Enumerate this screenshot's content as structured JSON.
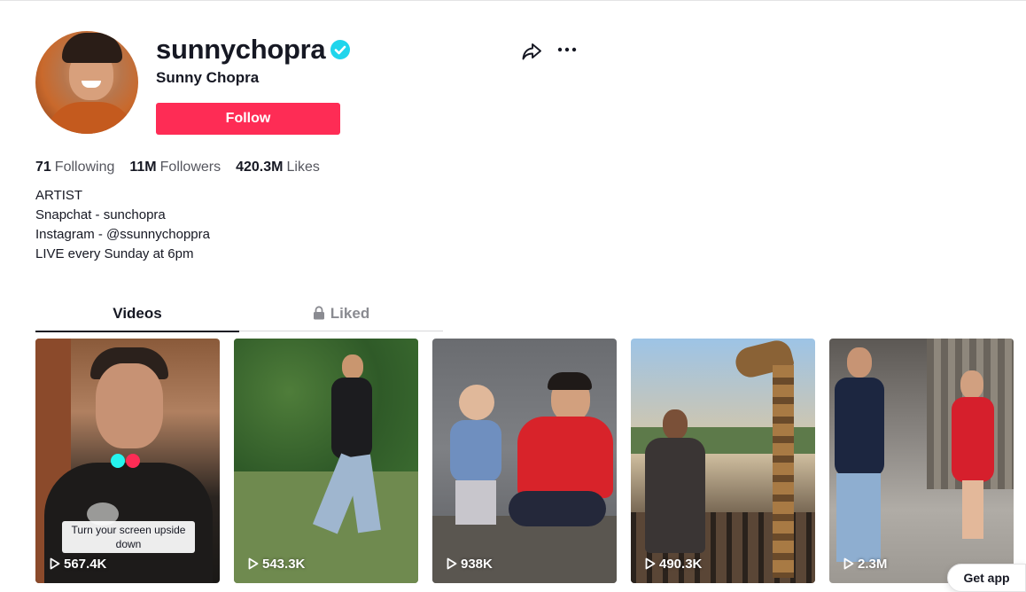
{
  "profile": {
    "username": "sunnychopra",
    "display_name": "Sunny Chopra",
    "follow_label": "Follow",
    "verified": true,
    "verified_color": "#20d5ec"
  },
  "stats": {
    "following_count": "71",
    "following_label": "Following",
    "followers_count": "11M",
    "followers_label": "Followers",
    "likes_count": "420.3M",
    "likes_label": "Likes"
  },
  "bio": {
    "lines": [
      "ARTIST",
      "Snapchat - sunchopra",
      "Instagram - @ssunnychoppra",
      "LIVE every Sunday at 6pm"
    ]
  },
  "tabs": {
    "videos_label": "Videos",
    "liked_label": "Liked"
  },
  "videos": [
    {
      "views": "567.4K",
      "caption": "Turn your screen upside down"
    },
    {
      "views": "543.3K"
    },
    {
      "views": "938K"
    },
    {
      "views": "490.3K"
    },
    {
      "views": "2.3M"
    }
  ],
  "floating": {
    "get_app_label": "Get app"
  },
  "colors": {
    "accent": "#fe2c55",
    "text": "#161823",
    "muted": "#8a8b91"
  },
  "icons": {
    "share": "share-icon",
    "more": "more-icon",
    "lock": "lock-icon",
    "play": "play-icon",
    "verified": "verified-badge-icon"
  }
}
